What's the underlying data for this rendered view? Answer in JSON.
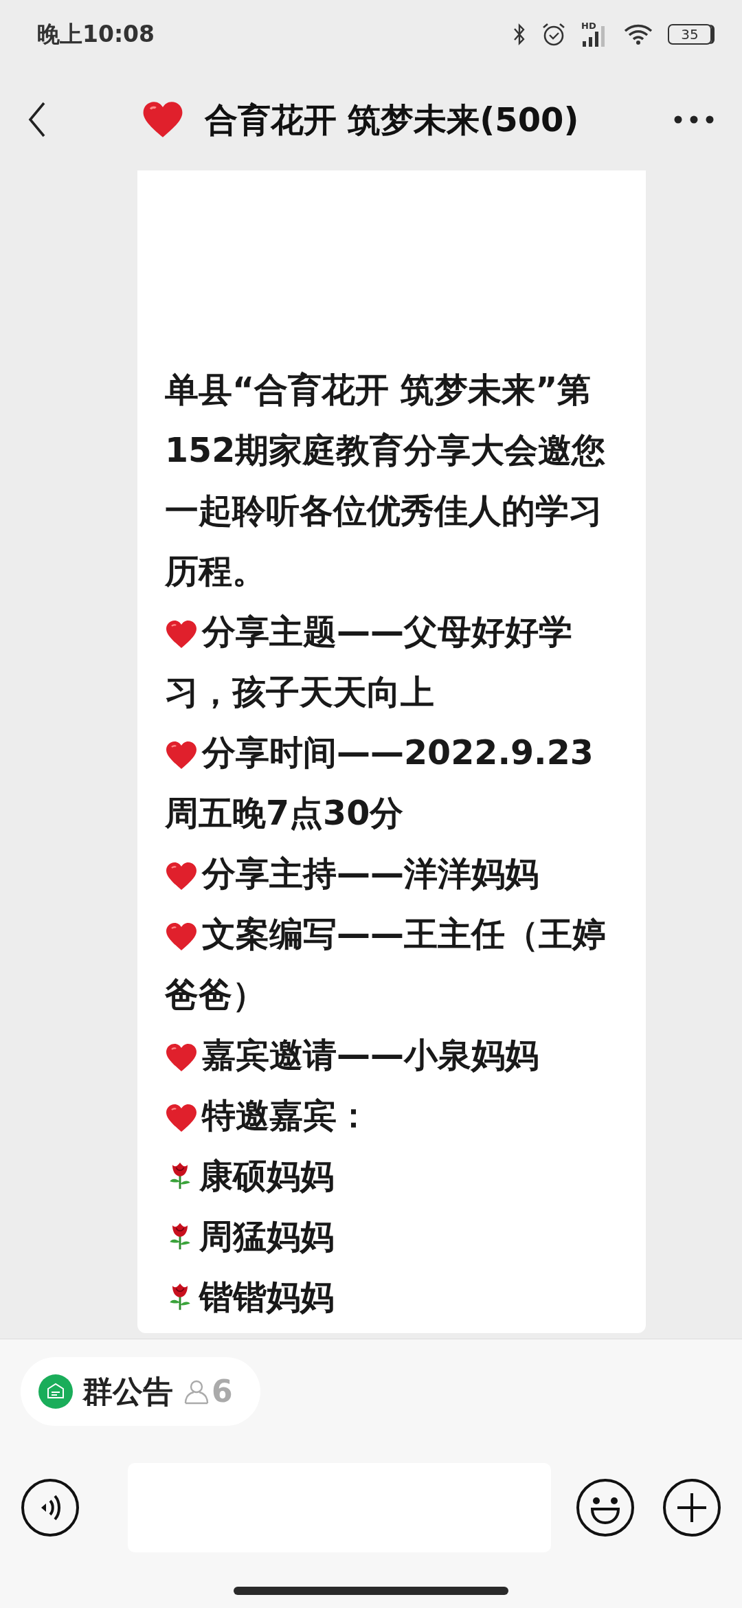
{
  "status_bar": {
    "time": "晚上10:08",
    "battery": "35",
    "network": "HD"
  },
  "header": {
    "title": "合育花开 筑梦未来(500)"
  },
  "message": {
    "lines": [
      {
        "kind": "text",
        "text": "单县“合育花开 筑梦未来”第152期家庭教育分享大会邀您一起聆听各位优秀佳人的学习历程。"
      },
      {
        "kind": "heart",
        "text": "分享主题——父母好好学习，孩子天天向上"
      },
      {
        "kind": "heart",
        "text": "分享时间——2022.9.23周五晚7点30分"
      },
      {
        "kind": "heart",
        "text": "分享主持——洋洋妈妈"
      },
      {
        "kind": "heart",
        "text": "文案编写——王主任（王婷爸爸）"
      },
      {
        "kind": "heart",
        "text": "嘉宾邀请——小泉妈妈"
      },
      {
        "kind": "heart",
        "text": "特邀嘉宾："
      },
      {
        "kind": "rose",
        "text": "康硕妈妈"
      },
      {
        "kind": "rose",
        "text": "周猛妈妈"
      },
      {
        "kind": "rose",
        "text": "锴锴妈妈"
      }
    ]
  },
  "announcement": {
    "label": "群公告",
    "count": "6"
  }
}
